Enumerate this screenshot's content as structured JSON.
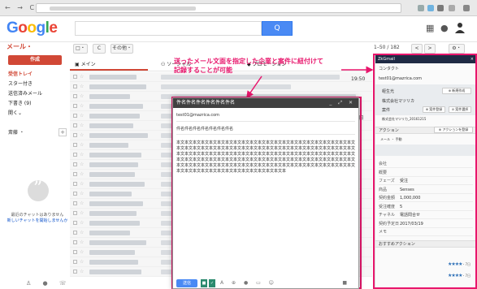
{
  "header": {
    "logo_letters": [
      {
        "ch": "G",
        "color": "#4285f4"
      },
      {
        "ch": "o",
        "color": "#ea4335"
      },
      {
        "ch": "o",
        "color": "#fbbc05"
      },
      {
        "ch": "g",
        "color": "#4285f4"
      },
      {
        "ch": "l",
        "color": "#34a853"
      },
      {
        "ch": "e",
        "color": "#ea4335"
      }
    ],
    "search_button": "Q",
    "apps_icon": "grid-icon",
    "notifications_icon": "bell-icon"
  },
  "toolbar": {
    "mail_label": "メール・",
    "select_label": "□・",
    "refresh_label": "C",
    "more_label": "その他・",
    "pager": "1–50 / 182",
    "prev": "<",
    "next": ">",
    "settings": "⚙・"
  },
  "sidebar": {
    "compose_label": "作成",
    "items": [
      {
        "label": "受信トレイ",
        "active": true
      },
      {
        "label": "スター付き",
        "active": false
      },
      {
        "label": "送信済みメール",
        "active": false
      },
      {
        "label": "下書き (9)",
        "active": false
      },
      {
        "label": "開く⌄",
        "active": false
      }
    ],
    "user_label": "斎藤 ・",
    "plus": "+",
    "hangouts_text": "最近のチャットはありません",
    "hangouts_link": "新しいチャットを開始しませんか",
    "bottom_icons": "♙ ● ☏"
  },
  "inbox": {
    "tabs": [
      {
        "label": "メイン",
        "icon": "inbox-icon"
      },
      {
        "label": "ソーシャル",
        "icon": "people-icon"
      },
      {
        "label": "プロモーション",
        "icon": "tag-icon"
      }
    ],
    "dates": [
      "19:50",
      "1月30日"
    ]
  },
  "compose": {
    "title": "件名件名件名件名件名件名",
    "to": "test01@mazrica.com",
    "subject": "件名件名件名件名件名件名件名",
    "body": "本文本文本文本文本文本文本文本文本文本文本文本文本文本文本文本文本文本文本文本文本文本文本文本文本文本文本文本文本文本文本文本文本文本文本文本文本文本文本文本文本文本文本文本文本文本文本文本文本文本文本文本文本文本文本文本文本文本文本文本文本文本文本文本文本文本文本文本文本文本文本文本文本文本文本文本文本文本文本文本文本文本文本文本文本文本文本文本文本文本文本文本文本文本文本文本文本文本文本文本文本文本文本文本文本文本文本文本文本文本文本文本文本文本文本文本文本文本文本文本文本文本文本文本",
    "send_label": "送信",
    "controls": "_ ⤢ ✕"
  },
  "annotation": {
    "line1": "送ったメール文面を指定した企業と案件に紐付けて",
    "line2": "記録することが可能",
    "color": "#e8166c"
  },
  "panel": {
    "title": "ZkGmail",
    "close": "×",
    "contact_tab": "コンタクト",
    "email": "test01@mazrica.com",
    "name": "蛭生光",
    "name_btn": "⊕ 新規作成",
    "company": "株式会社マツリカ",
    "deal_label": "案件",
    "deal_btn1": "⊕ 案件登録",
    "deal_btn2": "⊘ 案件選択",
    "deal_name": "株式会社マツリカ_20161215",
    "action_label": "アクション",
    "action_btn": "⊕ アクションを登録",
    "select_label": "メール ・ 手動",
    "fields": [
      {
        "k": "会社",
        "v": ""
      },
      {
        "k": "概要",
        "v": ""
      },
      {
        "k": "フェーズ",
        "v": "受注"
      },
      {
        "k": "商品",
        "v": "Senses"
      },
      {
        "k": "契約金額",
        "v": "1,000,000"
      },
      {
        "k": "受注確度",
        "v": "5"
      },
      {
        "k": "チャネル",
        "v": "電話問合せ"
      },
      {
        "k": "契約予定日",
        "v": "2017/03/19"
      },
      {
        "k": "メモ",
        "v": ""
      }
    ],
    "recommend_label": "おすすめアクション",
    "recommend_rows": [
      {
        "stars": "★★★★",
        "time": "・7日"
      },
      {
        "stars": "★★★★",
        "time": "・7日"
      }
    ]
  }
}
